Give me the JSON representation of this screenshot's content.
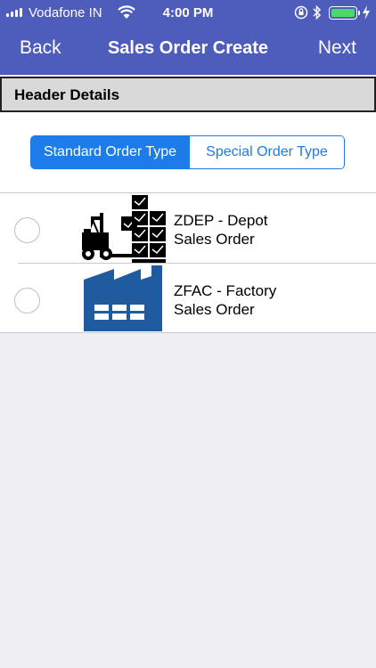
{
  "status_bar": {
    "carrier": "Vodafone IN",
    "time": "4:00 PM",
    "battery_level": 1.0,
    "battery_color": "#4cd964"
  },
  "nav": {
    "back_label": "Back",
    "title": "Sales Order Create",
    "next_label": "Next",
    "bar_color": "#4e5cbc"
  },
  "section": {
    "title": "Header Details"
  },
  "segmented": {
    "options": [
      "Standard Order Type",
      "Special Order Type"
    ],
    "selected": "Standard Order Type",
    "accent": "#1e7bea"
  },
  "order_types": [
    {
      "line1": "ZDEP - Depot",
      "line2": "Sales Order",
      "icon": "forklift-pallets-icon",
      "selected": false
    },
    {
      "line1": "ZFAC - Factory",
      "line2": "Sales Order",
      "icon": "factory-icon",
      "selected": false
    }
  ]
}
